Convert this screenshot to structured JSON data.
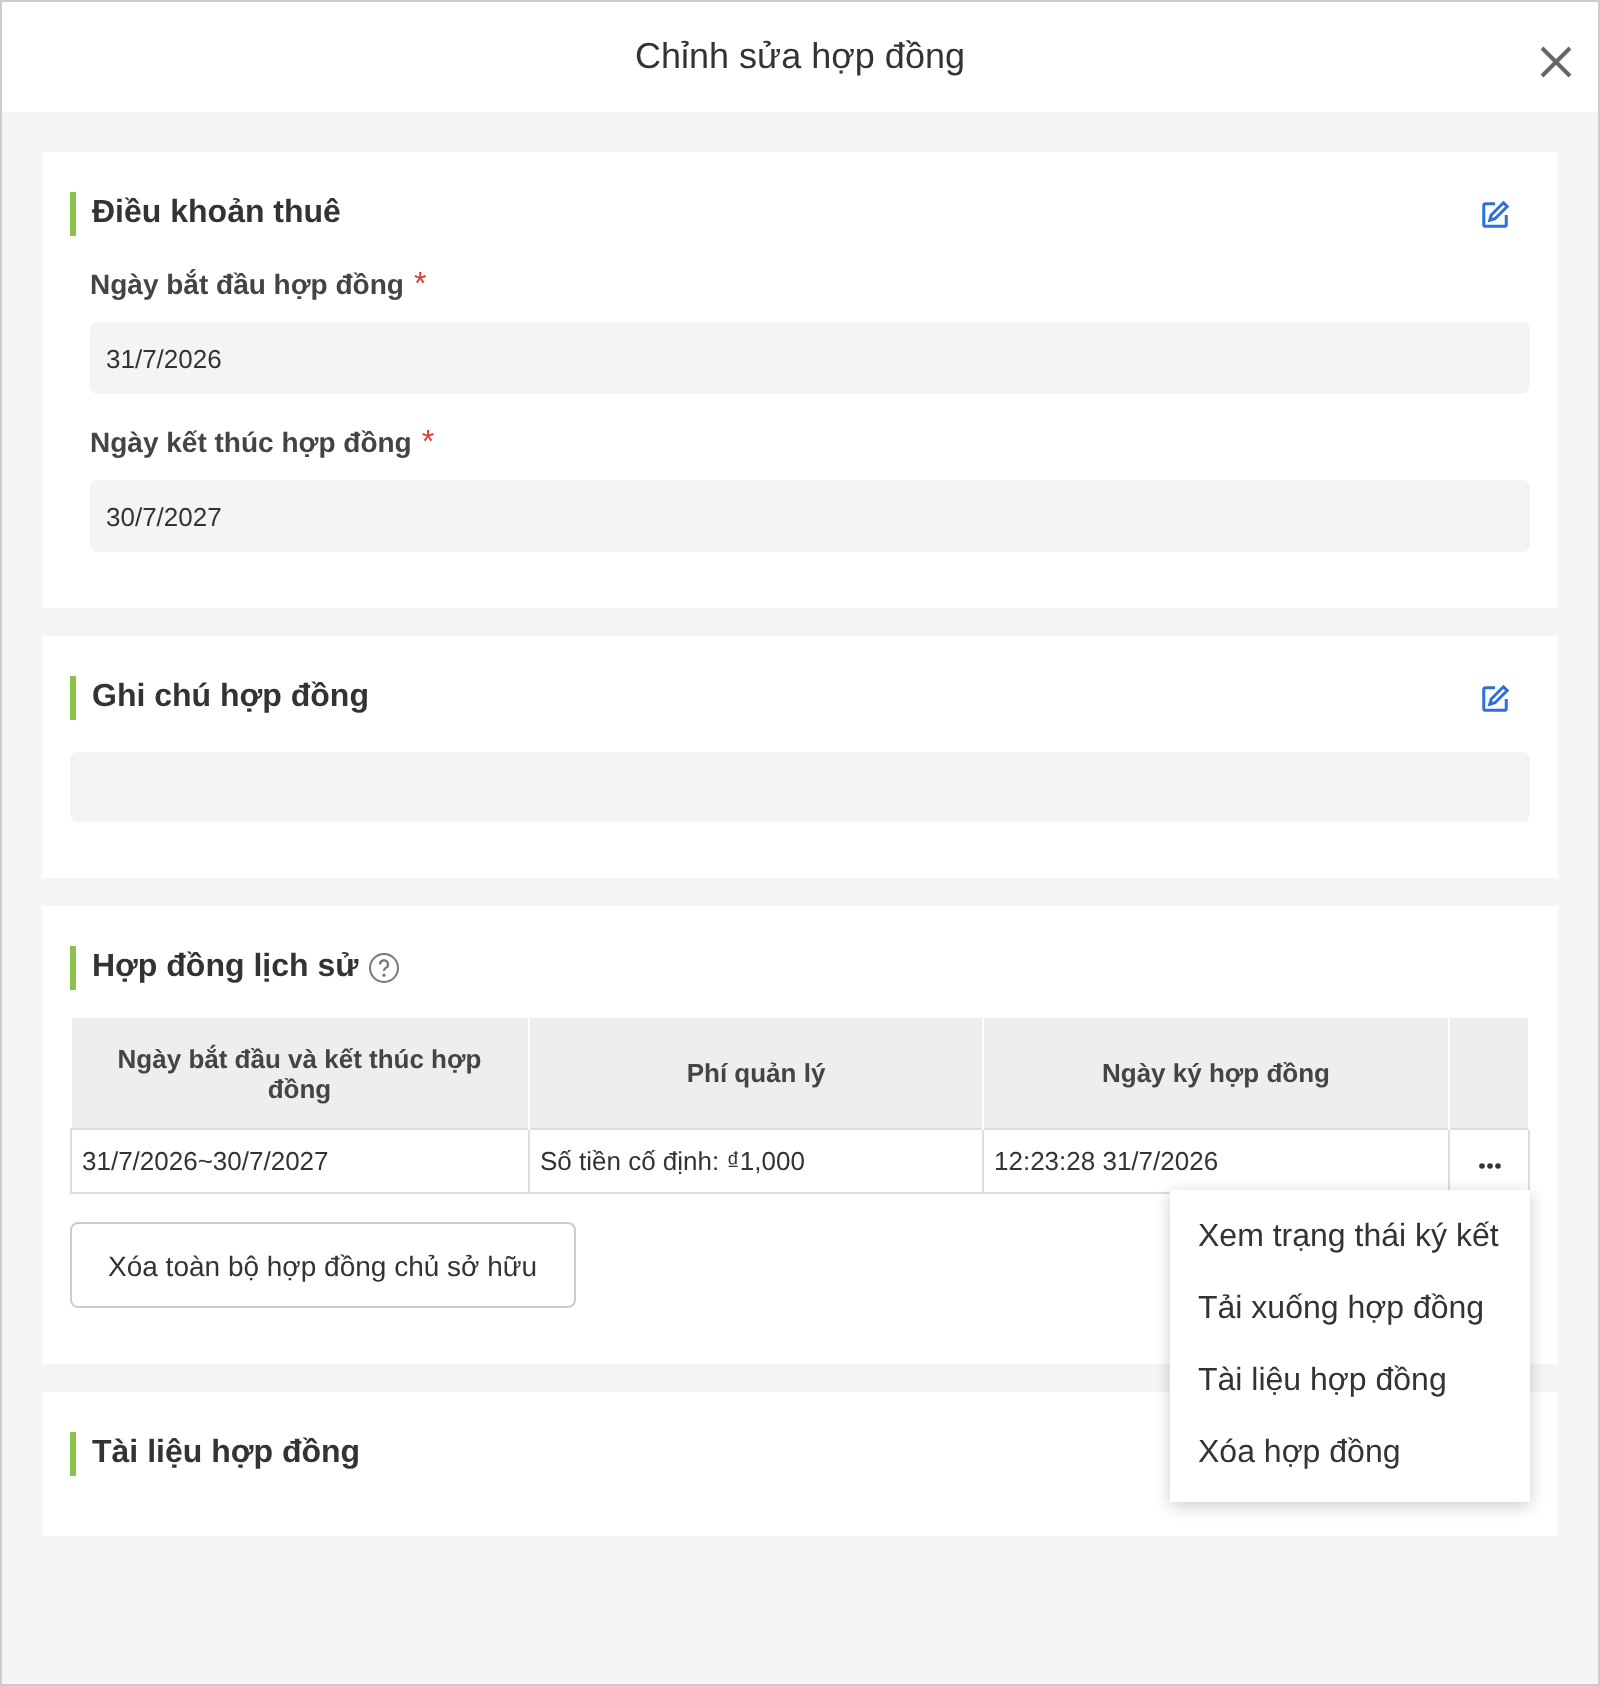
{
  "dialog": {
    "title": "Chỉnh sửa hợp đồng"
  },
  "lease_terms": {
    "title": "Điều khoản thuê",
    "fields": [
      {
        "label": "Ngày bắt đầu hợp đồng",
        "required_mark": "*",
        "value": "31/7/2026"
      },
      {
        "label": "Ngày kết thúc hợp đồng",
        "required_mark": "*",
        "value": "30/7/2027"
      }
    ]
  },
  "notes": {
    "title": "Ghi chú hợp đồng"
  },
  "history": {
    "title": "Hợp đồng lịch sử",
    "columns": [
      "Ngày bắt đầu và kết thúc hợp đồng",
      "Phí quản lý",
      "Ngày ký hợp đồng"
    ],
    "rows": [
      [
        "31/7/2026~30/7/2027",
        "Số tiền cố định: ₫1,000",
        "12:23:28 31/7/2026"
      ]
    ],
    "delete_all_button": "Xóa toàn bộ hợp đồng chủ sở hữu",
    "menu": [
      "Xem trạng thái ký kết",
      "Tải xuống hợp đồng",
      "Tài liệu hợp đồng",
      "Xóa hợp đồng"
    ]
  },
  "documents": {
    "title": "Tài liệu hợp đồng"
  }
}
